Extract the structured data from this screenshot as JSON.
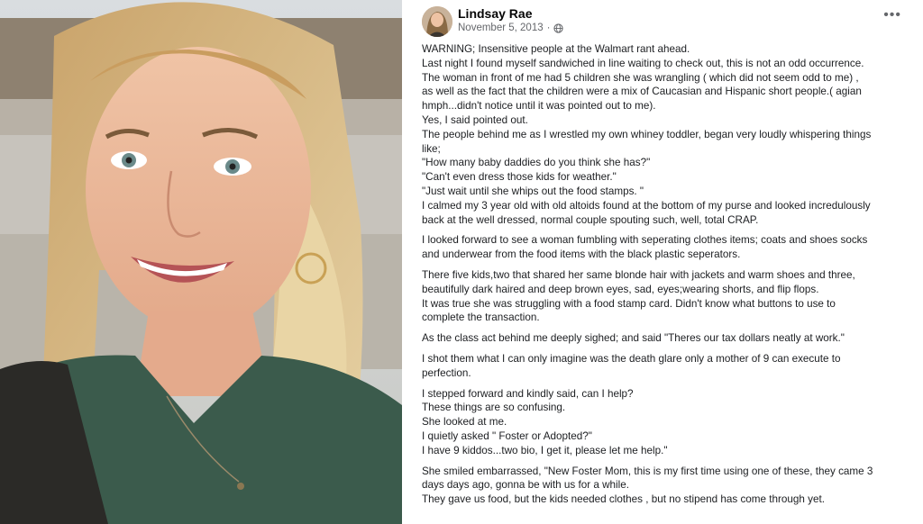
{
  "author": {
    "name": "Lindsay Rae",
    "date": "November 5, 2013",
    "audience_icon": "globe-icon"
  },
  "post_lines": [
    "WARNING; Insensitive people at the Walmart rant ahead.",
    "Last night I found myself sandwiched in line waiting to check out, this is not an odd occurrence.",
    "The woman in front of me had 5 children she was wrangling ( which did not seem odd to me) ,",
    "as well as the fact that the children were a  mix of Caucasian and  Hispanic short people.( agian",
    "hmph...didn't notice until it was pointed out to me).",
    "Yes, I said pointed out.",
    "The people behind me as I wrestled my own whiney toddler, began very loudly whispering things",
    "like;",
    "\"How many baby daddies do you think she has?\"",
    "\"Can't even dress those kids for weather.\"",
    "\"Just wait until she whips out the food stamps. \"",
    "I calmed my 3 year old with old altoids found at the bottom of my purse and looked incredulously",
    "back at the well dressed,  normal couple spouting such, well, total CRAP.",
    "I looked forward to see a woman fumbling with seperating clothes items; coats and shoes socks",
    "and underwear  from the food items with the black plastic  seperators.",
    "There five kids,two that shared her same blonde hair with jackets and warm shoes and three,",
    "beautifully dark haired and deep brown eyes, sad, eyes;wearing shorts, and flip flops.",
    "It was true she was struggling with a food stamp card. Didn't know what buttons to use to",
    "complete the transaction.",
    "As the class act behind me deeply sighed; and said \"Theres our tax dollars neatly at work.\"",
    "I shot them what I can only imagine was the death glare only a mother of 9 can execute to",
    "perfection.",
    "I stepped forward and kindly said, can I help?",
    "These things are so confusing.",
    "She looked at me.",
    "I quietly asked \" Foster or Adopted?\"",
    "I have 9 kiddos...two bio, I get it, please let me help.\"",
    "She smiled embarrassed, \"New Foster Mom, this is my first time using one of these, they came 3",
    "days days ago, gonna be with us for a while.",
    "They gave us food, but the kids needed clothes , but no stipend has come through yet."
  ],
  "paragraph_breaks_before": [
    13,
    15,
    19,
    20,
    22,
    27
  ]
}
